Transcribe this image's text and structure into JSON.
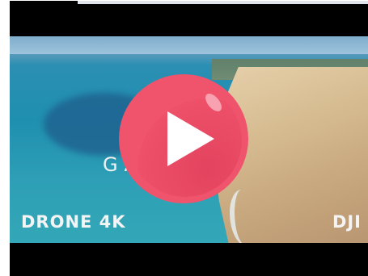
{
  "video": {
    "caption_left": "DRONE 4K",
    "caption_right": "DJI",
    "caption_title": "GA       S"
  },
  "player": {
    "play_icon": "play-icon",
    "play_color": "#f0546c"
  }
}
